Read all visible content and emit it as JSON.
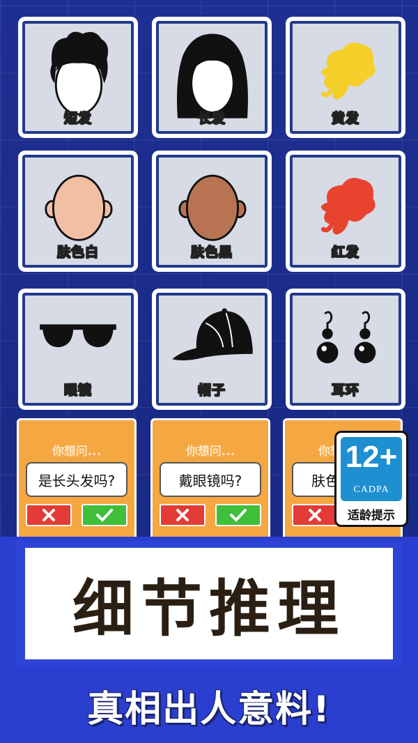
{
  "traits": [
    {
      "label": "短发",
      "icon": "short-hair-icon"
    },
    {
      "label": "长发",
      "icon": "long-hair-icon"
    },
    {
      "label": "黄发",
      "icon": "yellow-hair-icon"
    },
    {
      "label": "肤色白",
      "icon": "light-skin-face-icon"
    },
    {
      "label": "肤色黑",
      "icon": "dark-skin-face-icon"
    },
    {
      "label": "红发",
      "icon": "red-hair-icon"
    },
    {
      "label": "眼镜",
      "icon": "sunglasses-icon"
    },
    {
      "label": "帽子",
      "icon": "cap-icon"
    },
    {
      "label": "耳环",
      "icon": "earrings-icon"
    }
  ],
  "questions": [
    {
      "prompt": "你想问...",
      "text": "是长头发吗?"
    },
    {
      "prompt": "你想问...",
      "text": "戴眼镜吗?"
    },
    {
      "prompt": "你想问...",
      "text": "肤色"
    }
  ],
  "age_rating": {
    "number": "12+",
    "org": "CADPA",
    "tip": "适龄提示"
  },
  "banner": {
    "title": "细节推理",
    "subtitle": "真相出人意料!"
  },
  "colors": {
    "background": "#1c2b8a",
    "card_border": "#233a8c",
    "question_card": "#f5a742",
    "no_button": "#e33b35",
    "yes_button": "#3fbf3a",
    "badge_blue": "#1e8fd1",
    "yellow_hair": "#f5cf2a",
    "red_hair": "#e8432f",
    "light_skin": "#f2bfa4",
    "dark_skin": "#b87452"
  }
}
